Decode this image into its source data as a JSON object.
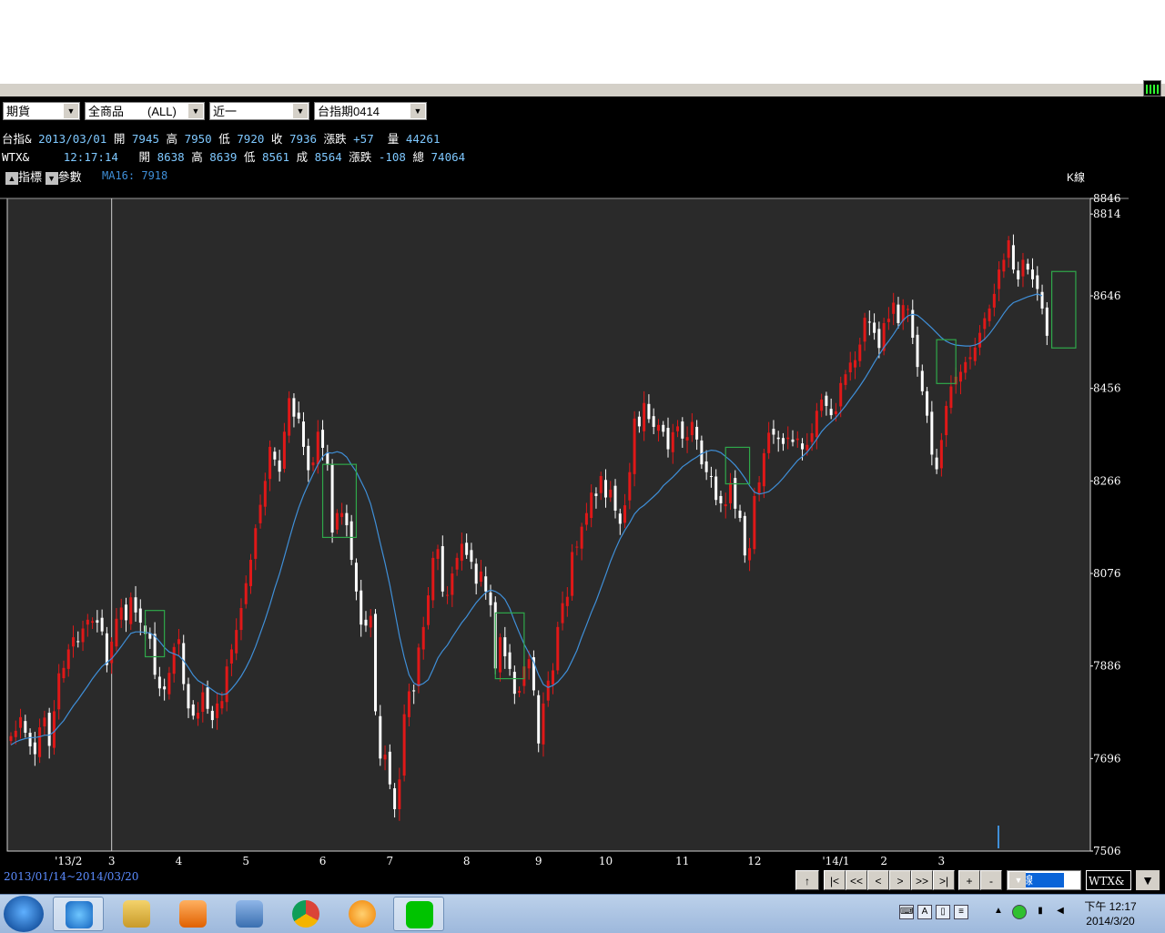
{
  "toolbar": {
    "market": "期貨",
    "category": "全商品　　(ALL)",
    "month": "近一",
    "contract": "台指期0414"
  },
  "quotes": [
    {
      "name": "台指&",
      "date": "2013/03/01",
      "open_label": "開",
      "open": "7945",
      "high_label": "高",
      "high": "7950",
      "low_label": "低",
      "low": "7920",
      "close_label": "收",
      "close": "7936",
      "chg_label": "漲跌",
      "chg": "+57",
      "vol_label": "量",
      "vol": "44261"
    },
    {
      "name": "WTX&",
      "date": "12:17:14",
      "open_label": "開",
      "open": "8638",
      "high_label": "高",
      "high": "8639",
      "low_label": "低",
      "low": "8561",
      "close_label": "成",
      "close": "8564",
      "chg_label": "漲跌",
      "chg": "-108",
      "vol_label": "總",
      "vol": "74064"
    }
  ],
  "indicator_btn": "指標",
  "param_btn": "參數",
  "ma_label": "MA16: 7918",
  "chart_kind": "K線",
  "range": "2013/01/14~2014/03/20",
  "nav_buttons": [
    "|<",
    "<<",
    "<",
    ">",
    ">>",
    ">|"
  ],
  "zoom_in": "+",
  "zoom_out": "-",
  "up_button": "↑",
  "period": "日線",
  "symbol": "WTX&",
  "clock": {
    "time": "下午 12:17",
    "date": "2014/3/20"
  },
  "colors": {
    "background": "#000000",
    "plot": "#2a2a2a",
    "up": "#e01818",
    "down": "#ffffff",
    "ma": "#3f8fd8",
    "box": "#2fa84a"
  },
  "chart_data": {
    "type": "candlestick",
    "title": "",
    "xlabel": "",
    "ylabel": "",
    "ylim": [
      7506,
      8846
    ],
    "y_ticks": [
      8846,
      8814,
      8646,
      8456,
      8266,
      8076,
      7886,
      7696,
      7506
    ],
    "x_ticks": [
      {
        "label": "'13/2",
        "i": 12
      },
      {
        "label": "3",
        "i": 21
      },
      {
        "label": "4",
        "i": 35
      },
      {
        "label": "5",
        "i": 49
      },
      {
        "label": "6",
        "i": 65
      },
      {
        "label": "7",
        "i": 79
      },
      {
        "label": "8",
        "i": 95
      },
      {
        "label": "9",
        "i": 110
      },
      {
        "label": "10",
        "i": 124
      },
      {
        "label": "11",
        "i": 140
      },
      {
        "label": "12",
        "i": 155
      },
      {
        "label": "'14/1",
        "i": 172
      },
      {
        "label": "3",
        "i": 194
      },
      {
        "label": "2",
        "i": 182
      }
    ],
    "cursor_index": 21,
    "series": [
      {
        "name": "close",
        "values": [
          7742,
          7753,
          7781,
          7749,
          7721,
          7705,
          7760,
          7780,
          7722,
          7793,
          7871,
          7882,
          7920,
          7945,
          7935,
          7963,
          7981,
          7978,
          7975,
          7957,
          7888,
          7936,
          7983,
          8006,
          7980,
          8027,
          7996,
          7975,
          7952,
          7942,
          7868,
          7840,
          7838,
          7872,
          7925,
          7941,
          7849,
          7799,
          7784,
          7790,
          7832,
          7798,
          7775,
          7809,
          7814,
          7885,
          7920,
          7960,
          8005,
          8056,
          8104,
          8169,
          8217,
          8266,
          8336,
          8310,
          8285,
          8367,
          8436,
          8398,
          8394,
          8336,
          8288,
          8304,
          8367,
          8334,
          8301,
          8160,
          8200,
          8200,
          8175,
          8104,
          8039,
          7971,
          7969,
          7989,
          7793,
          7696,
          7704,
          7643,
          7592,
          7653,
          7787,
          7834,
          7834,
          7924,
          7966,
          8031,
          8108,
          8126,
          8039,
          8032,
          8076,
          8108,
          8137,
          8114,
          8100,
          8055,
          8080,
          8039,
          8011,
          7881,
          7945,
          7906,
          7880,
          7829,
          7835,
          7885,
          7900,
          7836,
          7727,
          7809,
          7856,
          7877,
          7966,
          8015,
          8028,
          8120,
          8131,
          8172,
          8200,
          8242,
          8235,
          8276,
          8232,
          8248,
          8205,
          8178,
          8216,
          8284,
          8394,
          8378,
          8426,
          8393,
          8377,
          8381,
          8367,
          8331,
          8366,
          8378,
          8353,
          8356,
          8387,
          8351,
          8300,
          8284,
          8275,
          8227,
          8220,
          8218,
          8262,
          8209,
          8190,
          8113,
          8128,
          8235,
          8263,
          8323,
          8365,
          8361,
          8352,
          8342,
          8355,
          8346,
          8353,
          8331,
          8340,
          8364,
          8410,
          8433,
          8420,
          8401,
          8409,
          8467,
          8485,
          8509,
          8514,
          8546,
          8601,
          8591,
          8570,
          8539,
          8590,
          8599,
          8632,
          8590,
          8627,
          8619,
          8560,
          8500,
          8450,
          8400,
          8320,
          8290,
          8350,
          8420,
          8460,
          8480,
          8490,
          8510,
          8520,
          8540,
          8570,
          8600,
          8620,
          8650,
          8700,
          8720,
          8760,
          8700,
          8680,
          8720,
          8700,
          8680,
          8660,
          8620,
          8564
        ]
      },
      {
        "name": "MA16",
        "values": [
          7724,
          7730,
          7734,
          7737,
          7739,
          7739,
          7741,
          7744,
          7744,
          7751,
          7763,
          7774,
          7789,
          7804,
          7817,
          7831,
          7845,
          7860,
          7873,
          7885,
          7893,
          7901,
          7913,
          7926,
          7940,
          7953,
          7956,
          7956,
          7955,
          7954,
          7947,
          7936,
          7924,
          7915,
          7911,
          7907,
          7897,
          7883,
          7867,
          7856,
          7850,
          7844,
          7837,
          7830,
          7827,
          7829,
          7839,
          7851,
          7865,
          7882,
          7902,
          7926,
          7953,
          7981,
          8012,
          8045,
          8075,
          8110,
          8146,
          8180,
          8211,
          8237,
          8259,
          8280,
          8300,
          8316,
          8324,
          8323,
          8326,
          8323,
          8315,
          8299,
          8285,
          8265,
          8245,
          8219,
          8181,
          8138,
          8097,
          8052,
          8000,
          7947,
          7904,
          7868,
          7851,
          7846,
          7850,
          7858,
          7879,
          7902,
          7917,
          7929,
          7945,
          7960,
          7975,
          7987,
          8002,
          8016,
          8027,
          8037,
          8042,
          8039,
          8033,
          8023,
          8004,
          7978,
          7954,
          7931,
          7912,
          7894,
          7868,
          7848,
          7842,
          7846,
          7853,
          7864,
          7877,
          7897,
          7918,
          7945,
          7970,
          7996,
          8019,
          8046,
          8073,
          8101,
          8125,
          8147,
          8165,
          8180,
          8198,
          8209,
          8216,
          8225,
          8234,
          8243,
          8256,
          8265,
          8274,
          8284,
          8295,
          8302,
          8309,
          8315,
          8322,
          8326,
          8329,
          8328,
          8324,
          8316,
          8308,
          8298,
          8286,
          8272,
          8256,
          8243,
          8239,
          8241,
          8244,
          8252,
          8261,
          8272,
          8284,
          8296,
          8308,
          8316,
          8325,
          8338,
          8352,
          8367,
          8378,
          8387,
          8396,
          8408,
          8420,
          8434,
          8447,
          8461,
          8476,
          8492,
          8509,
          8525,
          8540,
          8553,
          8567,
          8582,
          8596,
          8605,
          8608,
          8606,
          8598,
          8589,
          8580,
          8570,
          8560,
          8553,
          8548,
          8545,
          8544,
          8543,
          8543,
          8545,
          8549,
          8557,
          8568,
          8581,
          8595,
          8610,
          8623,
          8632,
          8636,
          8640,
          8644,
          8647,
          8650,
          8646
        ]
      }
    ],
    "annotations": [
      "green box",
      "green box",
      "green box",
      "green box",
      "green box",
      "green box"
    ]
  }
}
